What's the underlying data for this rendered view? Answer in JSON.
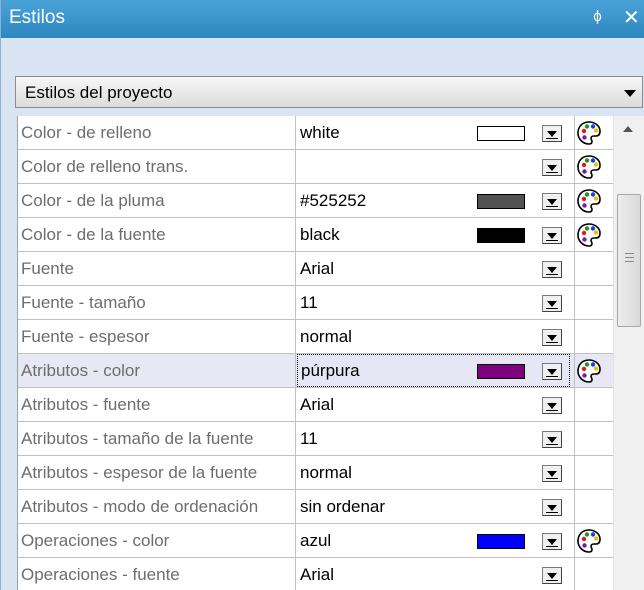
{
  "window": {
    "title": "Estilos",
    "pin_glyph": "ㅁ",
    "close_glyph": "✕"
  },
  "scope_combo": {
    "selected": "Estilos del proyecto"
  },
  "rows": [
    {
      "name": "Color - de relleno",
      "value": "white",
      "swatch": "#ffffff",
      "picker": true
    },
    {
      "name": "Color de relleno trans.",
      "value": "",
      "swatch": null,
      "picker": true
    },
    {
      "name": "Color - de la pluma",
      "value": "#525252",
      "swatch": "#525252",
      "picker": true
    },
    {
      "name": "Color - de la fuente",
      "value": "black",
      "swatch": "#000000",
      "picker": true
    },
    {
      "name": "Fuente",
      "value": "Arial",
      "swatch": null,
      "picker": false
    },
    {
      "name": "Fuente - tamaño",
      "value": "11",
      "swatch": null,
      "picker": false
    },
    {
      "name": "Fuente - espesor",
      "value": "normal",
      "swatch": null,
      "picker": false
    },
    {
      "name": "Atributos - color",
      "value": "púrpura",
      "swatch": "#800080",
      "picker": true,
      "selected": true
    },
    {
      "name": "Atributos - fuente",
      "value": "Arial",
      "swatch": null,
      "picker": false
    },
    {
      "name": "Atributos - tamaño de la fuente",
      "value": "11",
      "swatch": null,
      "picker": false
    },
    {
      "name": "Atributos - espesor de la fuente",
      "value": "normal",
      "swatch": null,
      "picker": false
    },
    {
      "name": "Atributos - modo de ordenación",
      "value": "sin ordenar",
      "swatch": null,
      "picker": false
    },
    {
      "name": "Operaciones - color",
      "value": "azul",
      "swatch": "#0000ff",
      "picker": true
    },
    {
      "name": "Operaciones - fuente",
      "value": "Arial",
      "swatch": null,
      "picker": false
    }
  ],
  "colors": {
    "title_bar": "#3a94cf",
    "panel_bg": "#d8e4f2",
    "selected_row": "#e8e8f4"
  },
  "scrollbar": {
    "position_fraction": 0.0
  }
}
